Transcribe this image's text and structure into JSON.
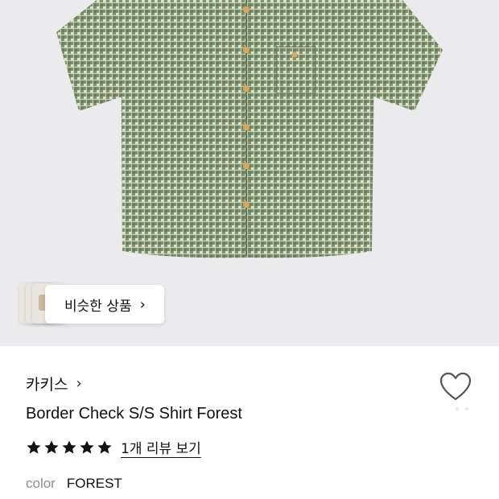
{
  "product_image": {
    "alt": "Border Check S/S Shirt Forest"
  },
  "similar_button": {
    "label": "비슷한 상품",
    "chevron": "›"
  },
  "brand": {
    "name": "카키스",
    "chevron": "›"
  },
  "product": {
    "title": "Border Check S/S Shirt Forest",
    "rating": 5,
    "review_link": "1개 리뷰 보기",
    "color_label": "color",
    "color_value": "FOREST"
  },
  "colors": {
    "shirt_base": "#8fa07a",
    "shirt_check": "#dfe4cf",
    "button": "#d9a860",
    "star": "#111111"
  }
}
